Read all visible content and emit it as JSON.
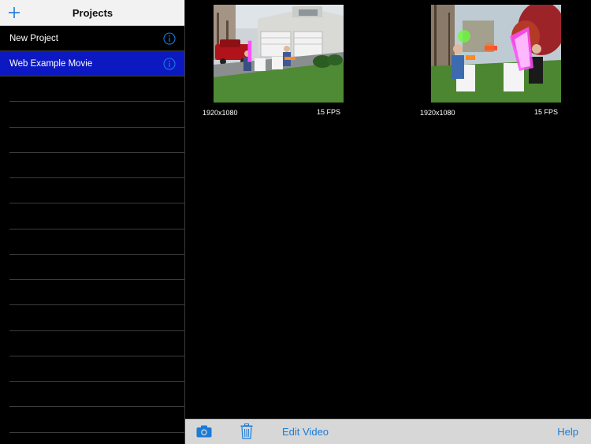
{
  "sidebar": {
    "title": "Projects",
    "add_icon": "plus-icon",
    "projects": [
      {
        "name": "New Project",
        "selected": false,
        "info_icon": "info-icon"
      },
      {
        "name": "Web Example Movie",
        "selected": true,
        "info_icon": "info-icon"
      }
    ]
  },
  "clips": [
    {
      "resolution": "1920x1080",
      "fps": "15 FPS",
      "thumbnail": "video-thumbnail"
    },
    {
      "resolution": "1920x1080",
      "fps": "15 FPS",
      "thumbnail": "video-thumbnail"
    }
  ],
  "toolbar": {
    "camera_icon": "camera-icon",
    "trash_icon": "trash-icon",
    "edit_video_label": "Edit Video",
    "help_label": "Help"
  },
  "colors": {
    "accent": "#1a7bd8",
    "selected_row": "#0c19c2",
    "header_bg": "#f2f2f2",
    "toolbar_bg": "#d7d7d7"
  }
}
